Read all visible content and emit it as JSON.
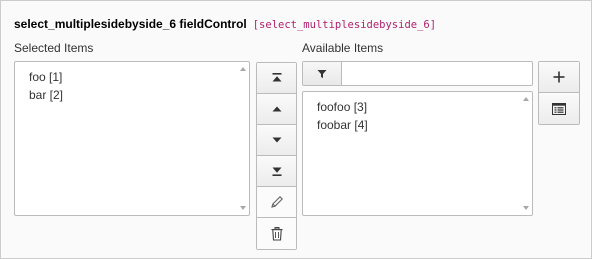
{
  "field": {
    "label": "select_multiplesidebyside_6 fieldControl",
    "code": "[select_multiplesidebyside_6]"
  },
  "selected": {
    "label": "Selected Items",
    "items": [
      "foo [1]",
      "bar [2]"
    ]
  },
  "available": {
    "label": "Available Items",
    "filter_value": "",
    "items": [
      "foofoo [3]",
      "foobar [4]"
    ]
  },
  "controls": {
    "move_top": "move-to-top-icon",
    "move_up": "caret-up-icon",
    "move_down": "caret-down-icon",
    "move_bottom": "move-to-bottom-icon",
    "edit": "pencil-icon",
    "delete": "trash-icon"
  },
  "actions": {
    "add": "plus-icon",
    "list": "list-icon"
  },
  "colors": {
    "code": "#b0216f",
    "border": "#bbbbbb",
    "icon": "#333333"
  }
}
